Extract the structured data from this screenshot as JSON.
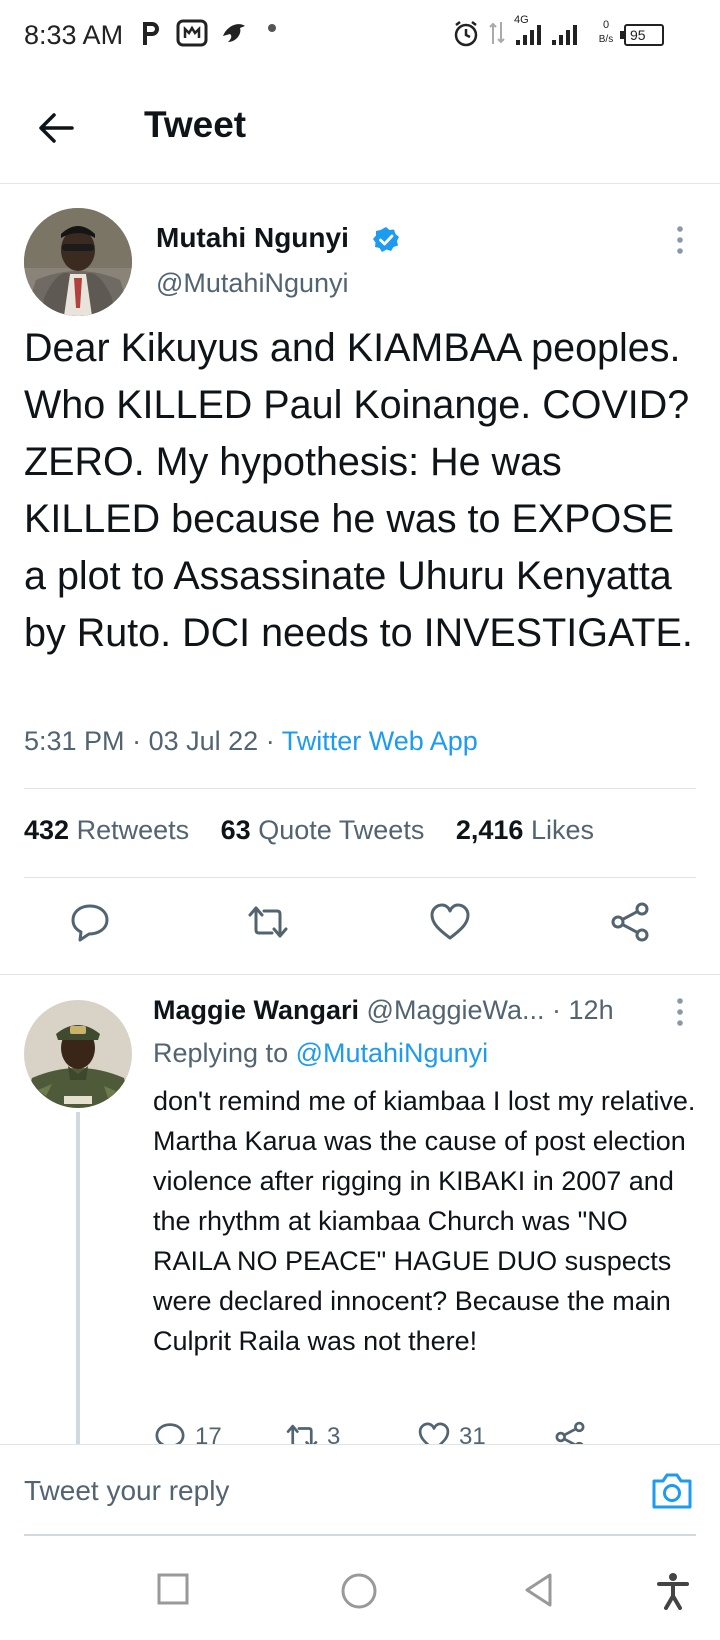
{
  "status_bar": {
    "time": "8:33 AM",
    "network": "4G",
    "speed_value": "0",
    "speed_unit": "B/s",
    "battery": "95"
  },
  "header": {
    "title": "Tweet"
  },
  "tweet": {
    "author_name": "Mutahi Ngunyi",
    "author_handle": "@MutahiNgunyi",
    "text": "Dear Kikuyus and KIAMBAA peoples. Who KILLED Paul Koinange. COVID? ZERO. My hypothesis: He was KILLED because he was to EXPOSE a plot to Assassinate Uhuru Kenyatta by Ruto. DCI needs to INVESTIGATE.",
    "time": "5:31 PM",
    "date": "03 Jul 22",
    "source": "Twitter Web App",
    "retweets_count": "432",
    "retweets_label": "Retweets",
    "quotes_count": "63",
    "quotes_label": "Quote Tweets",
    "likes_count": "2,416",
    "likes_label": "Likes"
  },
  "reply": {
    "name": "Maggie Wangari",
    "handle": "@MaggieWa...",
    "time": "12h",
    "replying_prefix": "Replying to",
    "replying_to": "@MutahiNgunyi",
    "text": "don't remind me of kiambaa I lost my relative. Martha Karua was the cause of post election violence after rigging in KIBAKI in 2007 and the rhythm at kiambaa Church was \"NO RAILA NO PEACE\" HAGUE DUO suspects were declared innocent? Because the main Culprit Raila was not there!",
    "replies_count": "17",
    "retweets_count": "3",
    "likes_count": "31"
  },
  "composer": {
    "placeholder": "Tweet your reply"
  },
  "colors": {
    "accent": "#1d9bf0",
    "text_primary": "#0f1419",
    "text_secondary": "#536471"
  }
}
